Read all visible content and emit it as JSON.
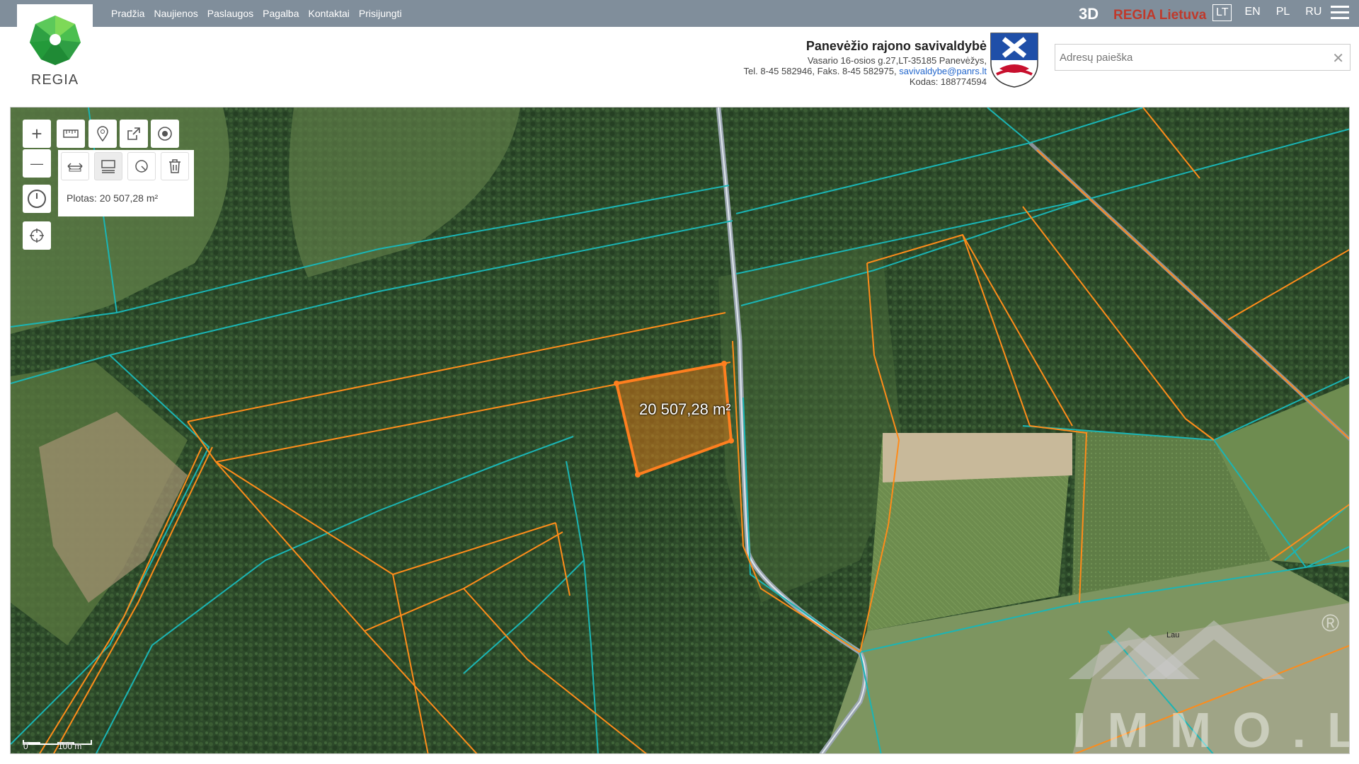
{
  "nav": {
    "items": [
      "Pradžia",
      "Naujienos",
      "Paslaugos",
      "Pagalba",
      "Kontaktai",
      "Prisijungti"
    ],
    "btn_3d": "3D",
    "regia_lietuva": "REGIA Lietuva",
    "languages": [
      "LT",
      "EN",
      "PL",
      "RU"
    ],
    "active_language": "LT"
  },
  "logo": {
    "text": "REGIA"
  },
  "municipality": {
    "name": "Panevėžio rajono savivaldybė",
    "address": "Vasario 16-osios g.27,LT-35185 Panevėžys,",
    "phones": "Tel. 8-45 582946, Faks. 8-45 582975,",
    "email": "savivaldybe@panrs.lt",
    "code": "Kodas: 188774594"
  },
  "search": {
    "placeholder": "Adresų paieška",
    "value": "",
    "clear_glyph": "✕"
  },
  "controls": {
    "zoom_in": "+",
    "zoom_out": "—"
  },
  "icons": [
    "plus-icon",
    "minus-icon",
    "ruler-icon",
    "pin-icon",
    "share-icon",
    "target-icon",
    "clock-icon",
    "locate-icon",
    "measure-line-icon",
    "measure-area-icon",
    "measure-circle-icon",
    "trash-icon"
  ],
  "measurement": {
    "area_label": "Plotas: 20 507,28 m²",
    "map_area_label": "20 507,28 m²"
  },
  "scale": {
    "start": "0",
    "end": "100 m"
  },
  "map_labels": {
    "lau": "Lau"
  },
  "watermark": {
    "text": "IMMO.LT",
    "reg": "®"
  },
  "colors": {
    "cadastral_orange": "#ff8c1a",
    "boundary_teal": "#1ab5b5",
    "selected_fill": "#d4761a",
    "selected_stroke": "#ff7f1f",
    "accent_red": "#c0392b",
    "topbar": "#808e9b"
  }
}
